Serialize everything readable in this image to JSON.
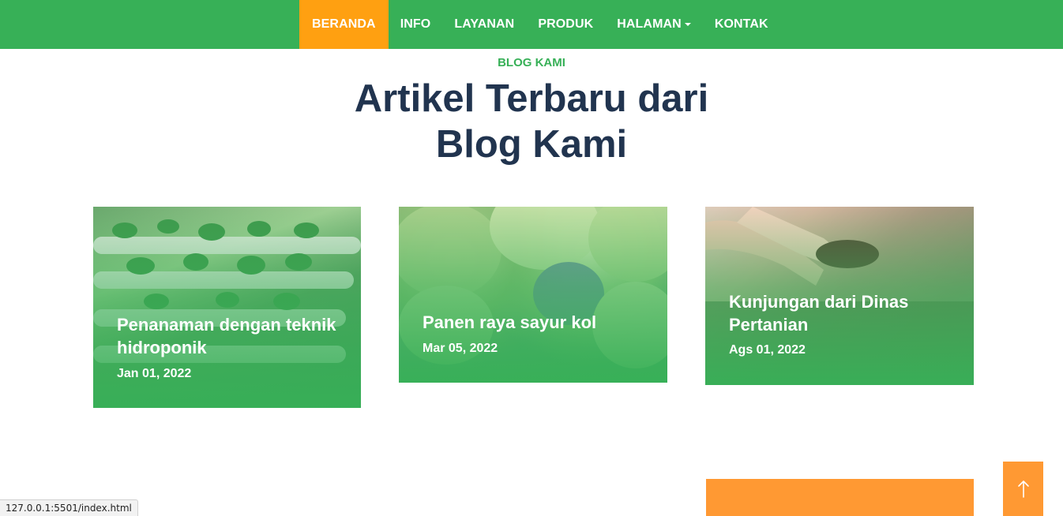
{
  "nav": {
    "items": [
      {
        "label": "BERANDA",
        "active": true
      },
      {
        "label": "INFO"
      },
      {
        "label": "LAYANAN"
      },
      {
        "label": "PRODUK"
      },
      {
        "label": "HALAMAN",
        "dropdown": true
      },
      {
        "label": "KONTAK"
      }
    ]
  },
  "blog": {
    "tag": "BLOG KAMI",
    "title_line1": "Artikel Terbaru dari",
    "title_line2": "Blog Kami",
    "cards": [
      {
        "title": "Penanaman dengan teknik hidroponik",
        "date": "Jan 01, 2022"
      },
      {
        "title": "Panen raya sayur kol",
        "date": "Mar 05, 2022"
      },
      {
        "title": "Kunjungan dari Dinas Pertanian",
        "date": "Ags 01, 2022"
      }
    ]
  },
  "status_bar": {
    "url": "127.0.0.1:5501/index.html"
  },
  "colors": {
    "brand_green": "#37b057",
    "accent_orange": "#ffa011",
    "heading_navy": "#21344f"
  },
  "icons": {
    "scroll_top": "arrow-up-icon",
    "dropdown": "caret-down-icon"
  }
}
